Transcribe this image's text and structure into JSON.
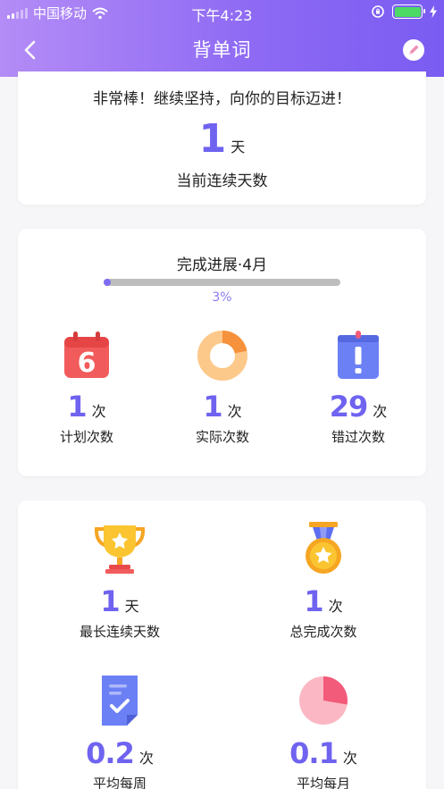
{
  "status_bar": {
    "carrier": "中国移动",
    "time": "下午4:23",
    "battery_level": 1.0
  },
  "nav": {
    "title": "背单词",
    "back_icon": "chevron-left-icon",
    "edit_icon": "pencil-icon"
  },
  "streak_card": {
    "motto": "非常棒！继续坚持，向你的目标迈进！",
    "value": "1",
    "unit": "天",
    "label": "当前连续天数"
  },
  "progress_card": {
    "title": "完成进展·4月",
    "percent_text": "3%",
    "percent": 3,
    "stats": [
      {
        "value": "1",
        "unit": "次",
        "label": "计划次数",
        "icon": "calendar-6-icon"
      },
      {
        "value": "1",
        "unit": "次",
        "label": "实际次数",
        "icon": "donut-chart-icon"
      },
      {
        "value": "29",
        "unit": "次",
        "label": "错过次数",
        "icon": "exclamation-clipboard-icon"
      }
    ]
  },
  "summary_card": {
    "stats": [
      {
        "value": "1",
        "unit": "天",
        "label": "最长连续天数",
        "icon": "trophy-icon"
      },
      {
        "value": "1",
        "unit": "次",
        "label": "总完成次数",
        "icon": "medal-icon"
      },
      {
        "value": "0.2",
        "unit": "次",
        "label": "平均每周",
        "icon": "checklist-icon"
      },
      {
        "value": "0.1",
        "unit": "次",
        "label": "平均每月",
        "icon": "pie-chart-icon"
      }
    ]
  },
  "colors": {
    "accent": "#6f63f0",
    "header_start": "#b48cf6",
    "header_end": "#7a5cf2"
  }
}
